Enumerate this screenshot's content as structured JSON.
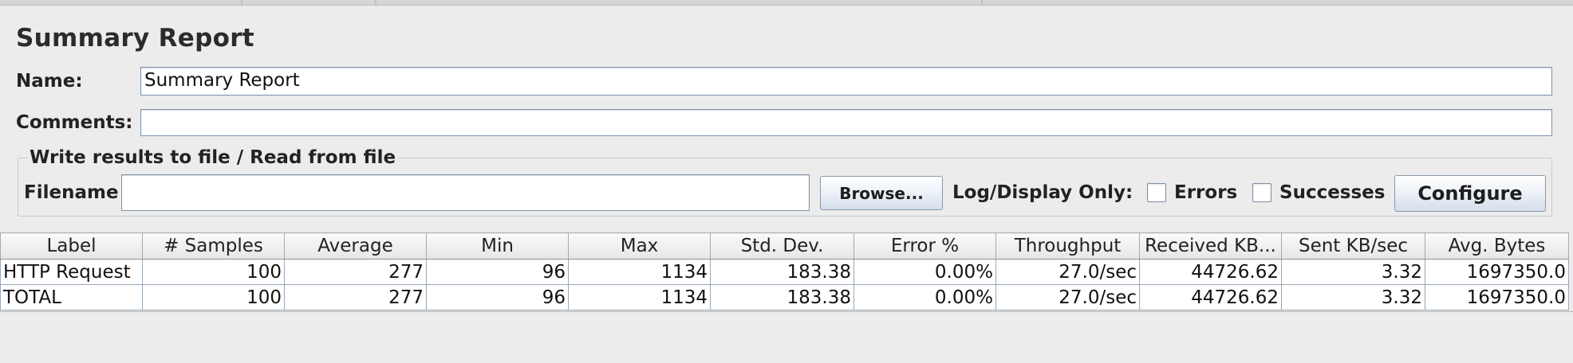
{
  "title": "Summary Report",
  "name_label": "Name:",
  "name_value": "Summary Report",
  "comments_label": "Comments:",
  "comments_value": "",
  "file_section": {
    "legend": "Write results to file / Read from file",
    "filename_label": "Filename",
    "filename_value": "",
    "browse_label": "Browse...",
    "log_display_label": "Log/Display Only:",
    "errors_label": "Errors",
    "errors_checked": false,
    "successes_label": "Successes",
    "successes_checked": false,
    "configure_label": "Configure"
  },
  "table": {
    "columns": [
      "Label",
      "# Samples",
      "Average",
      "Min",
      "Max",
      "Std. Dev.",
      "Error %",
      "Throughput",
      "Received KB...",
      "Sent KB/sec",
      "Avg. Bytes"
    ],
    "rows": [
      [
        "HTTP Request",
        "100",
        "277",
        "96",
        "1134",
        "183.38",
        "0.00%",
        "27.0/sec",
        "44726.62",
        "3.32",
        "1697350.0"
      ],
      [
        "TOTAL",
        "100",
        "277",
        "96",
        "1134",
        "183.38",
        "0.00%",
        "27.0/sec",
        "44726.62",
        "3.32",
        "1697350.0"
      ]
    ]
  }
}
